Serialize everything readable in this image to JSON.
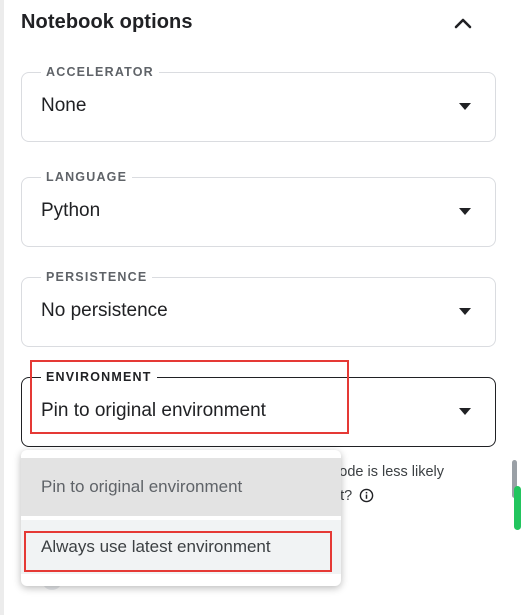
{
  "header": {
    "title": "Notebook options",
    "collapse_icon": "chevron-up-icon"
  },
  "fields": {
    "accelerator": {
      "label": "ACCELERATOR",
      "value": "None"
    },
    "language": {
      "label": "LANGUAGE",
      "value": "Python"
    },
    "persistence": {
      "label": "PERSISTENCE",
      "value": "No persistence"
    },
    "environment": {
      "label": "ENVIRONMENT",
      "value": "Pin to original environment"
    }
  },
  "environment_menu": {
    "options": [
      "Pin to original environment",
      "Always use latest environment"
    ]
  },
  "helper": {
    "line1": "code is less likely",
    "line2": "nt?",
    "icon": "info-icon"
  },
  "colors": {
    "highlight": "#e53935",
    "scroll_accent": "#22c55e",
    "text": "#202124"
  }
}
